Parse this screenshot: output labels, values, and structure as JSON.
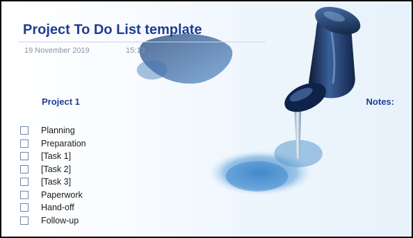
{
  "header": {
    "title": "Project To Do List template",
    "date": "19 November 2019",
    "time": "15:13"
  },
  "project": {
    "heading": "Project 1",
    "tasks": [
      {
        "label": "Planning",
        "checked": false
      },
      {
        "label": "Preparation",
        "checked": false
      },
      {
        "label": "[Task 1]",
        "checked": false
      },
      {
        "label": "[Task 2]",
        "checked": false
      },
      {
        "label": "[Task 3]",
        "checked": false
      },
      {
        "label": "Paperwork",
        "checked": false
      },
      {
        "label": "Hand-off",
        "checked": false
      },
      {
        "label": "Follow-up",
        "checked": false
      }
    ]
  },
  "notes": {
    "heading": "Notes:"
  },
  "colors": {
    "heading": "#1f3d8f",
    "pin": "#2b4d86",
    "shadow": "#5f9ad0"
  },
  "icons": {
    "background": "push-pin-illustration"
  }
}
